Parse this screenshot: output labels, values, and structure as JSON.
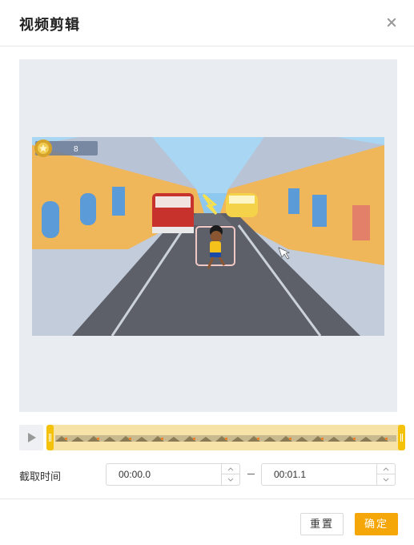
{
  "dialog": {
    "title": "视频剪辑",
    "close_icon": "close-icon"
  },
  "video": {
    "hud_coin_count": "8",
    "description_icon": "coin-icon"
  },
  "timeline": {
    "play_icon": "play-icon",
    "handle_color": "#f5c20b",
    "track_color": "#f7e3a8"
  },
  "time": {
    "label": "截取时间",
    "start": "00:00.0",
    "separator": "–",
    "end": "00:01.1"
  },
  "footer": {
    "reset_label": "重置",
    "ok_label": "确定",
    "ok_color": "#f5a70a"
  }
}
